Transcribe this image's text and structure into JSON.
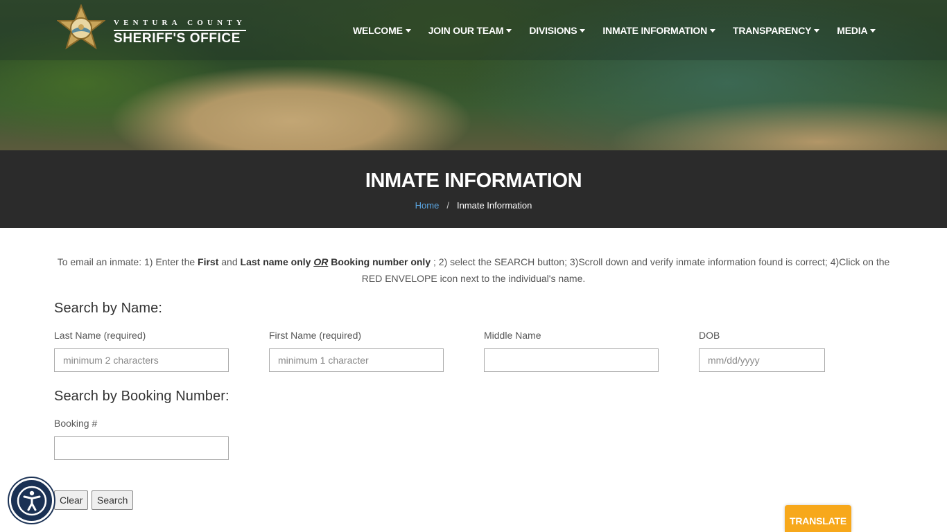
{
  "header": {
    "logo_county": "VENTURA COUNTY",
    "logo_office": "SHERIFF'S OFFICE",
    "nav": [
      {
        "label": "WELCOME"
      },
      {
        "label": "JOIN OUR TEAM"
      },
      {
        "label": "DIVISIONS"
      },
      {
        "label": "INMATE INFORMATION"
      },
      {
        "label": "TRANSPARENCY"
      },
      {
        "label": "MEDIA"
      }
    ]
  },
  "band": {
    "title": "INMATE INFORMATION",
    "breadcrumb_home": "Home",
    "breadcrumb_sep": "/",
    "breadcrumb_current": "Inmate Information"
  },
  "instructions": {
    "p1": "To email an inmate: 1) Enter the ",
    "b1": "First",
    "p2": " and ",
    "b2": "Last name only",
    "or": "OR",
    "b3": "Booking number only",
    "p3": " ; 2) select the SEARCH button;  3)Scroll down and verify inmate information found is correct; 4)Click on the RED ENVELOPE icon next to the individual's name."
  },
  "search_by_name": {
    "title": "Search by Name:",
    "last_name_label": "Last Name (required)",
    "last_name_placeholder": "minimum 2 characters",
    "first_name_label": "First Name (required)",
    "first_name_placeholder": "minimum 1 character",
    "middle_name_label": "Middle Name",
    "middle_name_placeholder": "",
    "dob_label": "DOB",
    "dob_placeholder": "mm/dd/yyyy"
  },
  "search_by_booking": {
    "title": "Search by Booking Number:",
    "booking_label": "Booking #",
    "booking_placeholder": ""
  },
  "buttons": {
    "clear": "Clear",
    "search": "Search"
  },
  "widgets": {
    "accessibility_icon": "accessibility-icon",
    "translate": "TRANSLATE"
  },
  "colors": {
    "band": "#2b2b2b",
    "link": "#5ba6e2",
    "translate": "#f7a81b",
    "accessibility": "#1a3154"
  }
}
